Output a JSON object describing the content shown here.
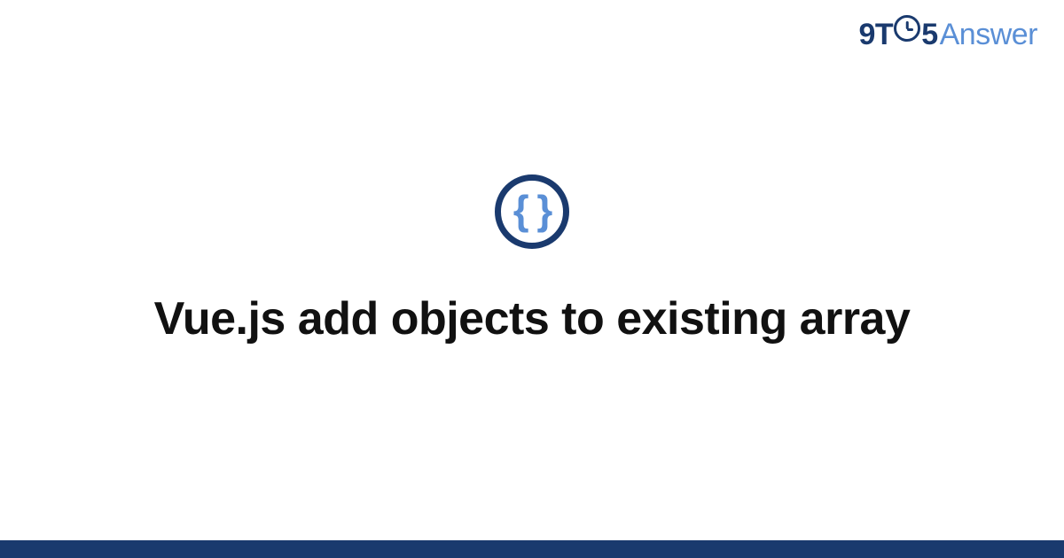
{
  "header": {
    "logo_prefix": "9T",
    "logo_suffix": "5",
    "logo_word": "Answer"
  },
  "topic": {
    "icon_glyph": "{ }",
    "icon_name": "braces-icon"
  },
  "main": {
    "title": "Vue.js add objects to existing array"
  }
}
